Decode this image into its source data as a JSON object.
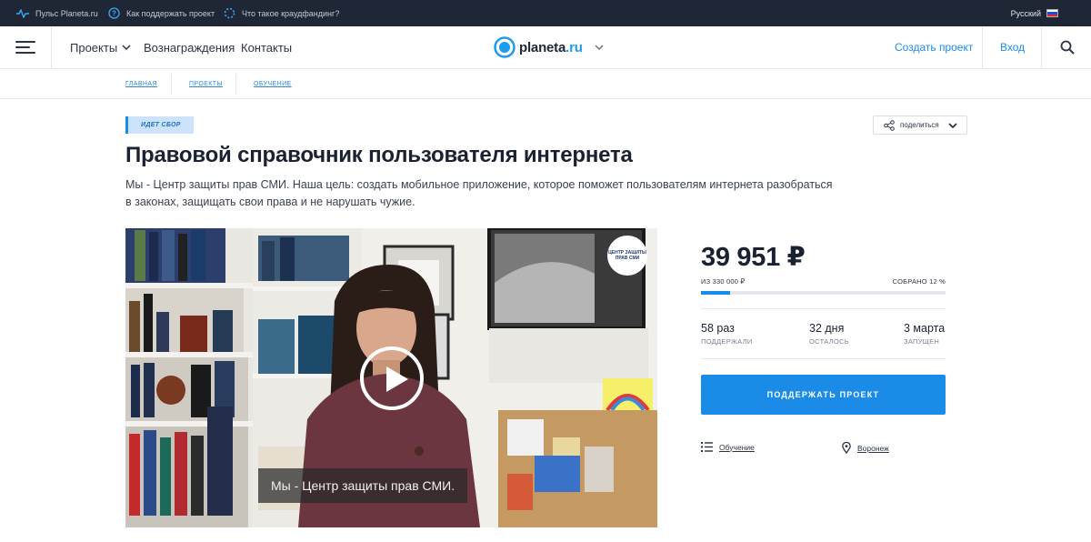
{
  "topbar": {
    "pulse_label": "Пульс Planeta.ru",
    "support_label": "Как поддержать проект",
    "crowdfunding_label": "Что такое краудфандинг?",
    "language": "Русский"
  },
  "header": {
    "nav": [
      "Проекты",
      "Вознаграждения",
      "Контакты"
    ],
    "logo_text": "planeta",
    "logo_suffix": ".ru",
    "create_project": "Создать проект",
    "login": "Вход"
  },
  "breadcrumbs": [
    "ГЛАВНАЯ",
    "ПРОЕКТЫ",
    "ОБУЧЕНИЕ"
  ],
  "project": {
    "status_badge": "ИДЕТ СБОР",
    "share_label": "поделиться",
    "title": "Правовой справочник пользователя интернета",
    "description": "Мы - Центр защиты прав СМИ. Наша цель: создать мобильное приложение, которое поможет пользователям интернета разобраться в законах, защищать свои права и не нарушать чужие.",
    "video_subtitle": "Мы - Центр защиты прав СМИ.",
    "video_logo_text": "ЦЕНТР ЗАЩИТЫ ПРАВ СМИ"
  },
  "funding": {
    "amount": "39 951 ₽",
    "goal": "ИЗ 330 000 ₽",
    "collected": "СОБРАНО 12 %",
    "progress_fraction": 0.12,
    "stats": [
      {
        "value": "58 раз",
        "label": "ПОДДЕРЖАЛИ"
      },
      {
        "value": "32 дня",
        "label": "ОСТАЛОСЬ"
      },
      {
        "value": "3 марта",
        "label": "ЗАПУЩЕН"
      }
    ],
    "support_button": "ПОДДЕРЖАТЬ ПРОЕКТ",
    "category": "Обучение",
    "city": "Воронеж"
  },
  "colors": {
    "accent": "#1a8ce8",
    "topbar": "#1f2736"
  }
}
